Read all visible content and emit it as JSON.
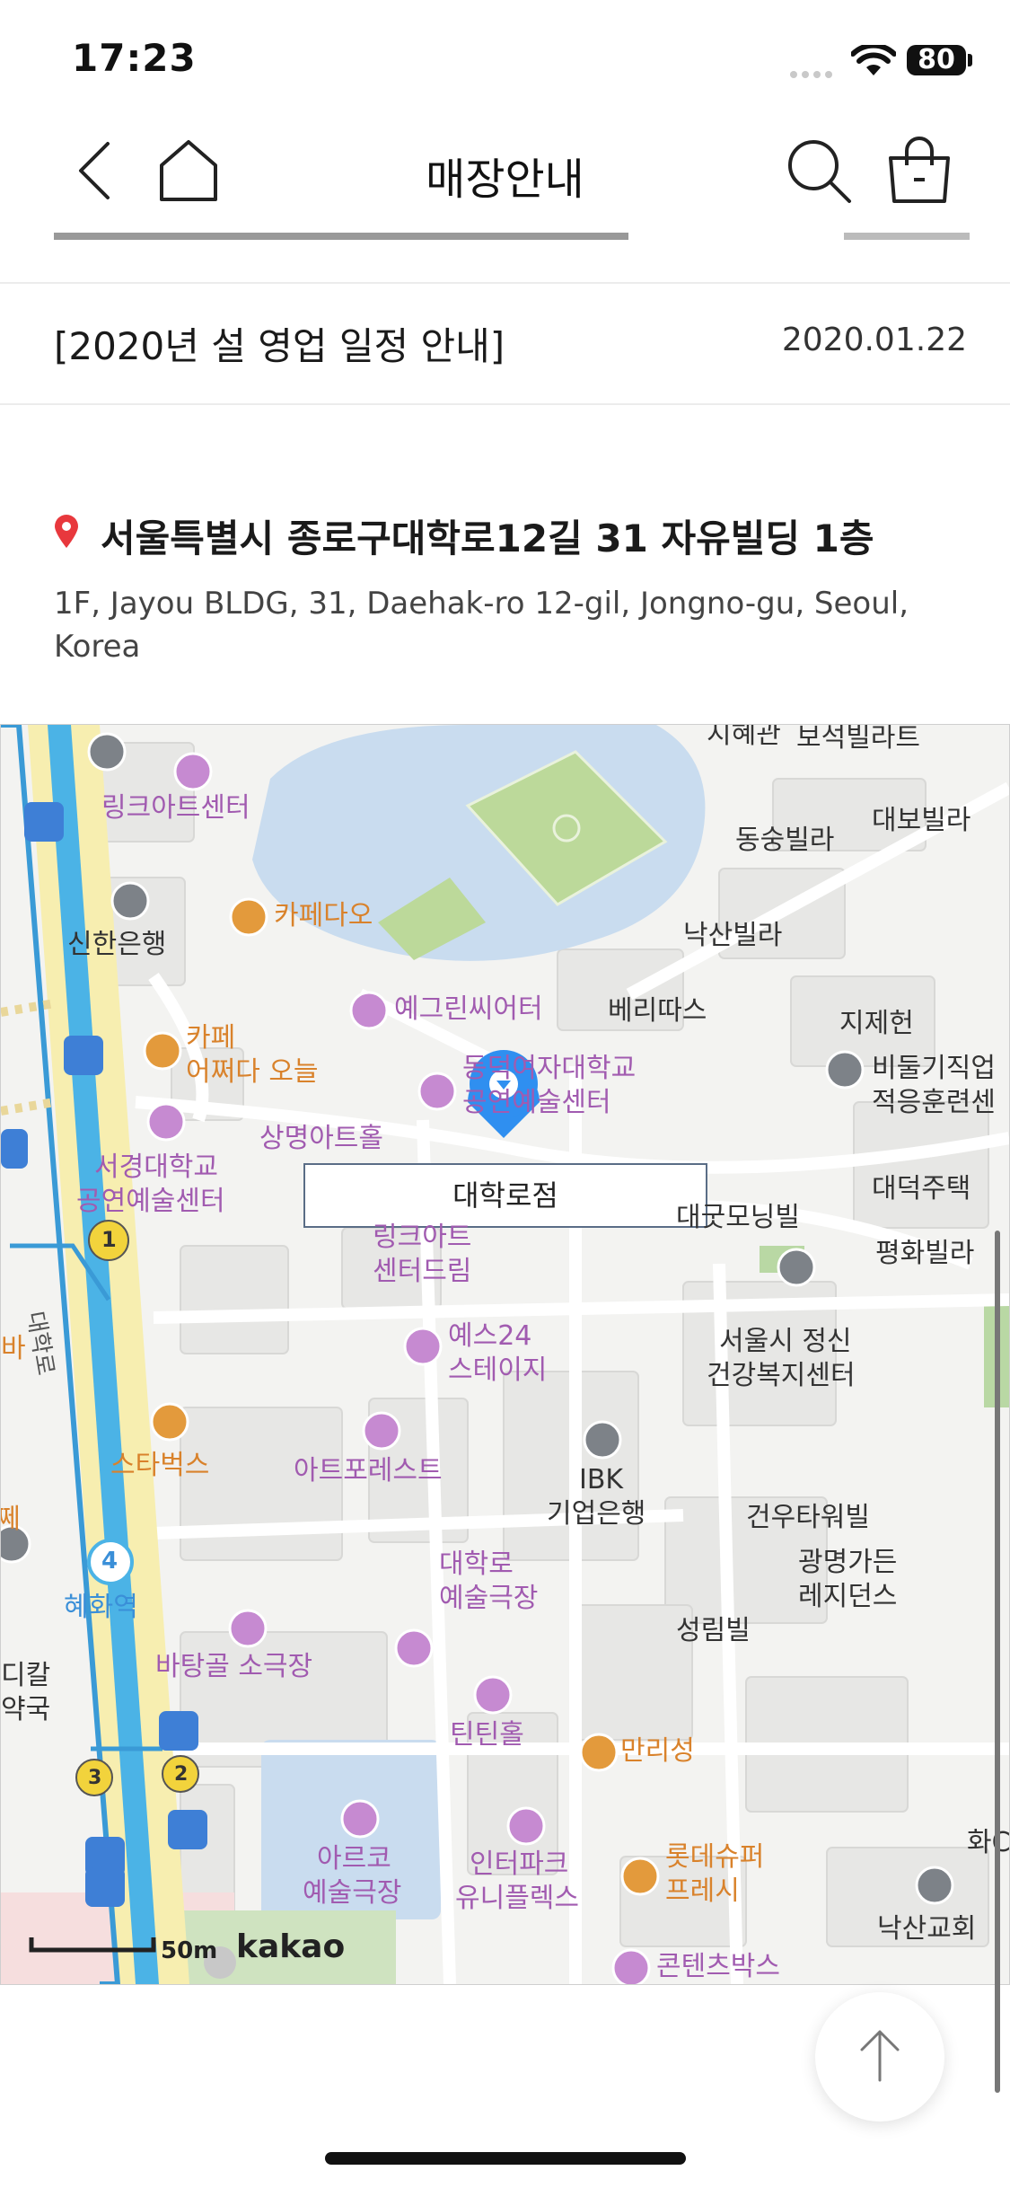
{
  "status_bar": {
    "time": "17:23",
    "battery": "80"
  },
  "header": {
    "title": "매장안내"
  },
  "notice": {
    "title": "[2020년 설 영업 일정 안내]",
    "date": "2020.01.22"
  },
  "address": {
    "korean": "서울특별시 종로구대학로12길 31 자유빌딩 1층",
    "english": "1F, Jayou BLDG, 31, Daehak-ro 12-gil, Jongno-gu, Seoul, Korea"
  },
  "map": {
    "store_label": "대학로점",
    "scale": "50m",
    "brand": "kakao",
    "places": {
      "link_art_center": "링크아트센터",
      "cafe_dao": "카페다오",
      "shinhan": "신한은행",
      "yegreen": "예그린씨어터",
      "cafe_oneul_1": "카페",
      "cafe_oneul_2": "어쩌다 오늘",
      "dongduk_1": "동덕여자대학교",
      "dongduk_2": "공연예술센터",
      "sangmyung": "상명아트홀",
      "seokyeong_1": "서경대학교",
      "seokyeong_2": "공연예술센터",
      "linkart_dream_1": "링크아트",
      "linkart_dream_2": "센터드림",
      "yes24_1": "예스24",
      "yes24_2": "스테이지",
      "starbucks": "스타벅스",
      "artforest": "아트포레스트",
      "ibk_1": "IBK",
      "ibk_2": "기업은행",
      "daehak_theater_1": "대학로",
      "daehak_theater_2": "예술극장",
      "hyehwa": "혜화역",
      "batanggol": "바탕골 소극장",
      "tintin": "틴틴홀",
      "manriseong": "만리성",
      "arko_1": "아르코",
      "arko_2": "예술극장",
      "interpark_1": "인터파크",
      "interpark_2": "유니플렉스",
      "lotte_1": "롯데슈퍼",
      "lotte_2": "프레시",
      "contents": "콘텐츠박스",
      "jihyegwan": "지혜관",
      "boseok": "보석빌라트",
      "daebo": "대보빌라",
      "dongsung": "동숭빌라",
      "naksan_villa": "낙산빌라",
      "beriddas": "베리따스",
      "jijeheon": "지제헌",
      "bidulgi_1": "비둘기직업",
      "bidulgi_2": "적응훈련센",
      "daedeok": "대덕주택",
      "daegood": "대굿모닝빌",
      "pyeonghwa": "평화빌라",
      "mental_1": "서울시 정신",
      "mental_2": "건강복지센터",
      "gunwoo": "건우타워빌",
      "gwangmyeong_1": "광명가든",
      "gwangmyeong_2": "레지던스",
      "seongrim": "성림빌",
      "naksan_church": "낙산교회",
      "daehak_road": "대학로",
      "edge_ba": "바",
      "edge_jjet": "쩨",
      "edge_dikal_1": "디칼",
      "edge_dikal_2": "약국",
      "edge_hwa": "화C"
    },
    "line_badges": [
      "1",
      "4",
      "3",
      "2"
    ]
  }
}
